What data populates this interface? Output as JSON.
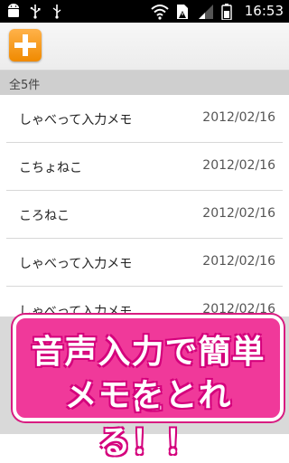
{
  "status_bar": {
    "time": "16:53",
    "left_icons": [
      "android-icon",
      "usb-icon",
      "usb-icon"
    ],
    "right_icons": [
      "wifi-icon",
      "sim-alert-icon",
      "signal-icon",
      "battery-icon"
    ]
  },
  "toolbar": {
    "add_button_icon": "plus-icon",
    "accent": "#f08a00"
  },
  "list_header": {
    "count_text": "全5件"
  },
  "memos": [
    {
      "title": "しゃべって入力メモ",
      "date": "2012/02/16"
    },
    {
      "title": "こちょねこ",
      "date": "2012/02/16"
    },
    {
      "title": "ころねこ",
      "date": "2012/02/16"
    },
    {
      "title": "しゃべって入力メモ",
      "date": "2012/02/16"
    },
    {
      "title": "しゃべって入力メモ",
      "date": "2012/02/16"
    }
  ],
  "promo": {
    "line1": "音声入力で簡単に",
    "line2": "メモをとれる！！",
    "color": "#f0399a"
  }
}
